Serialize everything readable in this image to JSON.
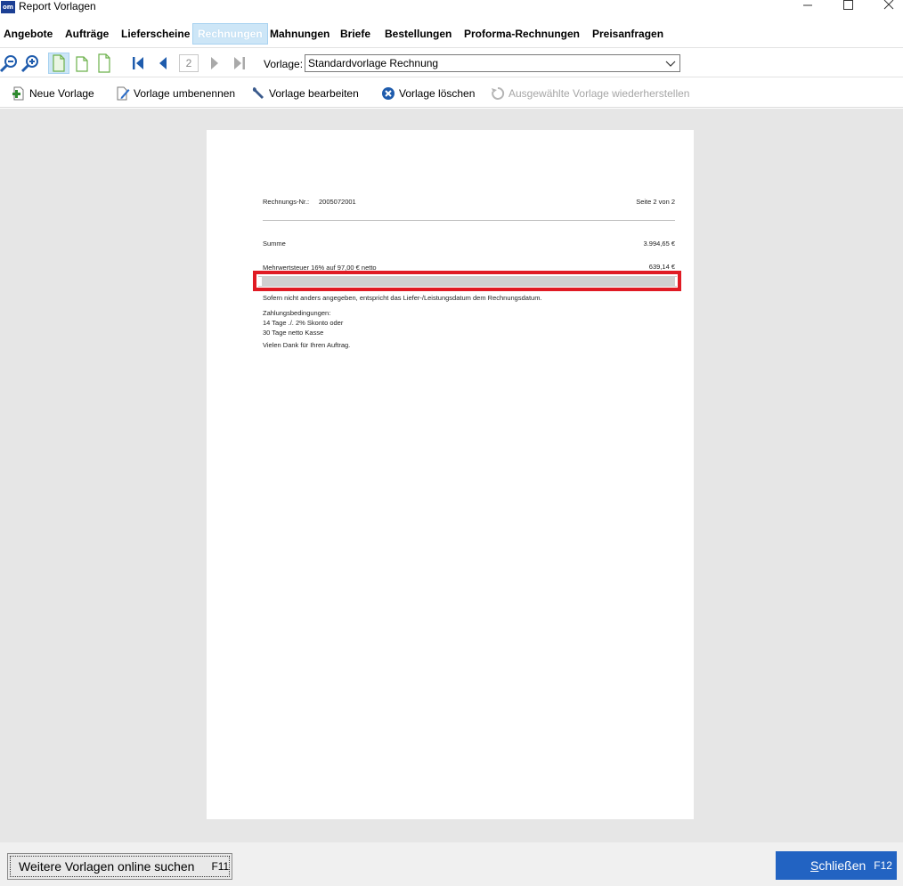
{
  "window": {
    "title": "Report Vorlagen",
    "app_icon_text": "om"
  },
  "tabs": [
    {
      "label": "Angebote",
      "active": false
    },
    {
      "label": "Aufträge",
      "active": false
    },
    {
      "label": "Lieferscheine",
      "active": false
    },
    {
      "label": "Rechnungen",
      "active": true
    },
    {
      "label": "Mahnungen",
      "active": false
    },
    {
      "label": "Briefe",
      "active": false
    },
    {
      "label": "Bestellungen",
      "active": false
    },
    {
      "label": "Proforma-Rechnungen",
      "active": false
    },
    {
      "label": "Preisanfragen",
      "active": false
    }
  ],
  "toolbar": {
    "page_number": "2",
    "vorlage_label": "Vorlage:",
    "vorlage_value": "Standardvorlage Rechnung"
  },
  "actions": {
    "neue_vorlage": "Neue Vorlage",
    "umbenennen": "Vorlage umbenennen",
    "bearbeiten": "Vorlage bearbeiten",
    "loeschen": "Vorlage löschen",
    "wiederherstellen": "Ausgewählte Vorlage wiederherstellen"
  },
  "document": {
    "rechnungs_nr_label": "Rechnungs-Nr.:",
    "rechnungs_nr": "2005072001",
    "seite": "Seite 2 von 2",
    "summe_label": "Summe",
    "summe_value": "3.994,65 €",
    "mwst_label": "Mehrwertsteuer 16% auf 97,00 € netto",
    "mwst_value": "639,14 €",
    "hinweis": "Sofern nicht anders angegeben, entspricht das Liefer-/Leistungsdatum dem Rechnungsdatum.",
    "zahlungsbedingungen_title": "Zahlungsbedingungen:",
    "zahlung_1": "14 Tage ./. 2% Skonto oder",
    "zahlung_2": "30 Tage netto Kasse",
    "dank": "Vielen Dank für Ihren Auftrag."
  },
  "bottom": {
    "online_label": "Weitere Vorlagen online suchen",
    "online_key": "F11",
    "close_label": "Schließen",
    "close_key": "F12"
  },
  "colors": {
    "accent": "#2263c2",
    "highlight": "#e01b24",
    "tab_active_bg": "#cde6f7"
  }
}
